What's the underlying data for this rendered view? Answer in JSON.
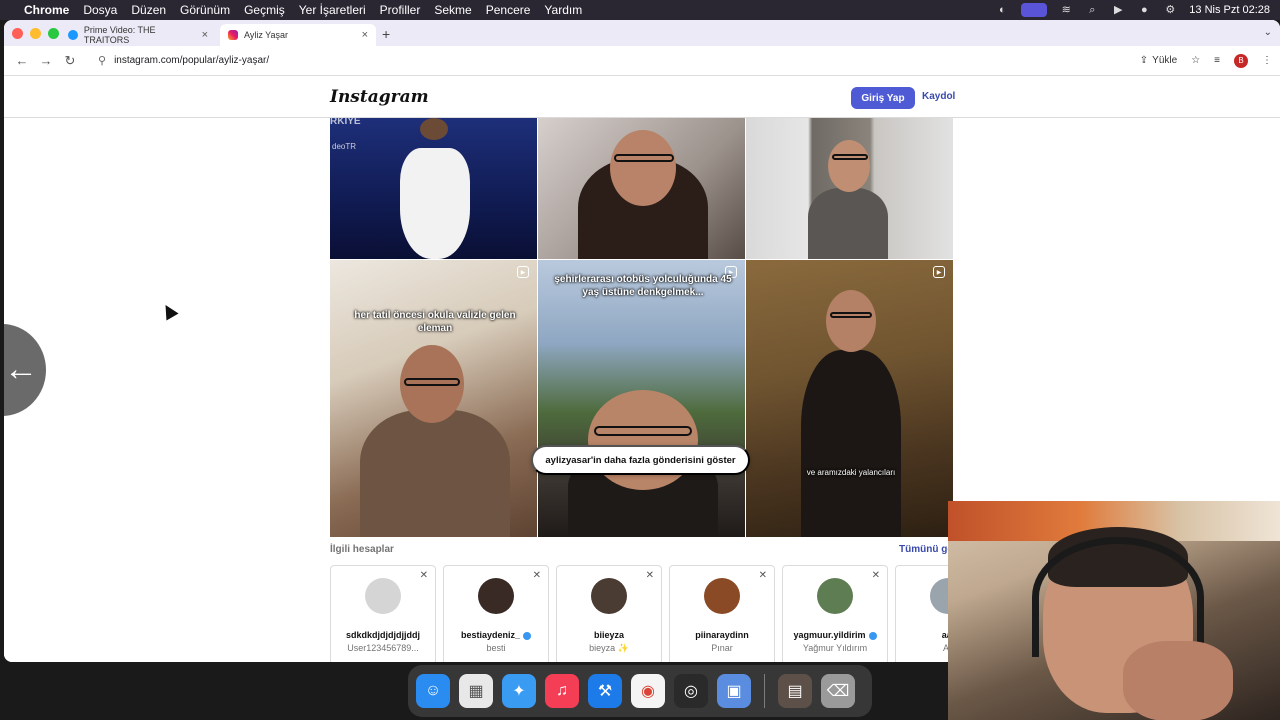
{
  "menubar": {
    "app_name": "Chrome",
    "items": [
      "Dosya",
      "Düzen",
      "Görünüm",
      "Geçmiş",
      "Yer İşaretleri",
      "Profiller",
      "Sekme",
      "Pencere",
      "Yardım"
    ],
    "clock": "13 Nis Pzt  02:28"
  },
  "browser": {
    "tabs": [
      {
        "title": "Prime Video: THE TRAITORS",
        "active": false
      },
      {
        "title": "Ayliz Yaşar",
        "active": true
      }
    ],
    "url": "instagram.com/popular/ayliz-yaşar/",
    "upload_label": "Yükle",
    "profile_initial": "B"
  },
  "instagram": {
    "logo": "Instagram",
    "login_label": "Giriş Yap",
    "signup_label": "Kaydol",
    "posts": [
      {
        "overlay": "",
        "watermark": "deoTR",
        "top_watermark": "RKIYE"
      },
      {
        "overlay": ""
      },
      {
        "overlay": ""
      },
      {
        "overlay": "her tatil öncesi okula valizle gelen eleman"
      },
      {
        "overlay": "şehirlerarası otobüs yolculuğunda 45 yaş üstüne denkgelmek..."
      },
      {
        "overlay": "ve aramızdaki yalancıları"
      }
    ],
    "more_posts_label": "aylizyasar'in daha fazla gönderisini göster",
    "related_title": "İlgili hesaplar",
    "see_all_label": "Tümünü gö",
    "related_accounts": [
      {
        "username": "sdkdkdjdjdjdjjddj",
        "subtitle": "User123456789...",
        "verified": false,
        "color": "#cfcfcf"
      },
      {
        "username": "bestiaydeniz_",
        "subtitle": "besti",
        "verified": true,
        "color": "#3a2a26"
      },
      {
        "username": "biieyza",
        "subtitle": "bieyza ✨",
        "verified": false,
        "color": "#4a3b33"
      },
      {
        "username": "piinaraydinn",
        "subtitle": "Pınar",
        "verified": false,
        "color": "#8a4a25"
      },
      {
        "username": "yagmuur.yildirim",
        "subtitle": "Yağmur Yıldırım",
        "verified": true,
        "color": "#5f7d52"
      },
      {
        "username": "aal",
        "subtitle": "Ali",
        "verified": false,
        "color": "#9aa4ad"
      }
    ]
  },
  "dock": {
    "apps": [
      {
        "name": "finder-icon",
        "color": "#2a8cf0",
        "glyph": "☺"
      },
      {
        "name": "launchpad-icon",
        "color": "#e8e8e8",
        "glyph": "▦"
      },
      {
        "name": "safari-icon",
        "color": "#3a9bf3",
        "glyph": "✦"
      },
      {
        "name": "music-icon",
        "color": "#f43e56",
        "glyph": "♫"
      },
      {
        "name": "xcode-icon",
        "color": "#1c7be8",
        "glyph": "⚒"
      },
      {
        "name": "chrome-icon",
        "color": "#f4f4f4",
        "glyph": "◉"
      },
      {
        "name": "obs-icon",
        "color": "#2a2a2a",
        "glyph": "◎"
      },
      {
        "name": "simulator-icon",
        "color": "#5a8de0",
        "glyph": "▣"
      }
    ],
    "right_apps": [
      {
        "name": "archive-icon",
        "color": "#5c5048",
        "glyph": "▤"
      },
      {
        "name": "trash-icon",
        "color": "#9a9a9a",
        "glyph": "🗑"
      }
    ]
  }
}
